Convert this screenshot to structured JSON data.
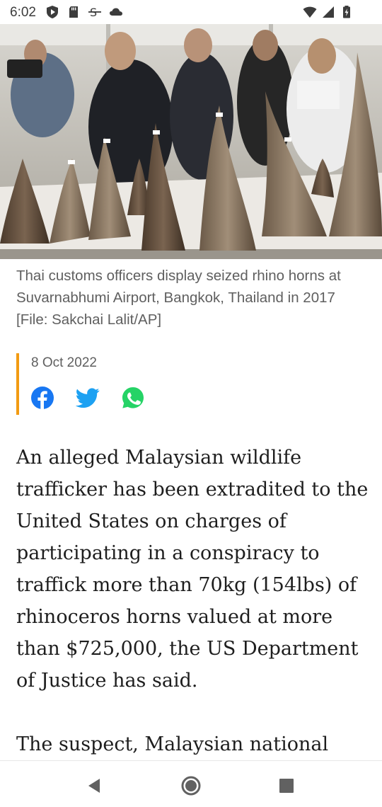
{
  "status_bar": {
    "time": "6:02"
  },
  "hero": {
    "image_label": "seized-rhino-horns-photo"
  },
  "caption": "Thai customs officers display seized rhino horns at Suvarnabhumi Airport, Bangkok, Thailand in 2017 [File: Sakchai Lalit/AP]",
  "meta": {
    "date": "8 Oct 2022",
    "accent_color": "#f29b12"
  },
  "share": {
    "facebook_color": "#1877f2",
    "twitter_color": "#1da1f2",
    "whatsapp_color": "#25d366"
  },
  "article": {
    "paragraph_1": "An alleged Malaysian wildlife trafficker has been extradited to the United States on charges of participating in a conspiracy to traffick more than 70kg (154lbs) of rhinoceros horns valued at more than $725,000, the US Department of Justice has said.",
    "paragraph_2": "The suspect, Malaysian national"
  },
  "nav": {
    "back_icon": "back-triangle-icon",
    "home_icon": "home-circle-icon",
    "recents_icon": "recents-square-icon"
  }
}
